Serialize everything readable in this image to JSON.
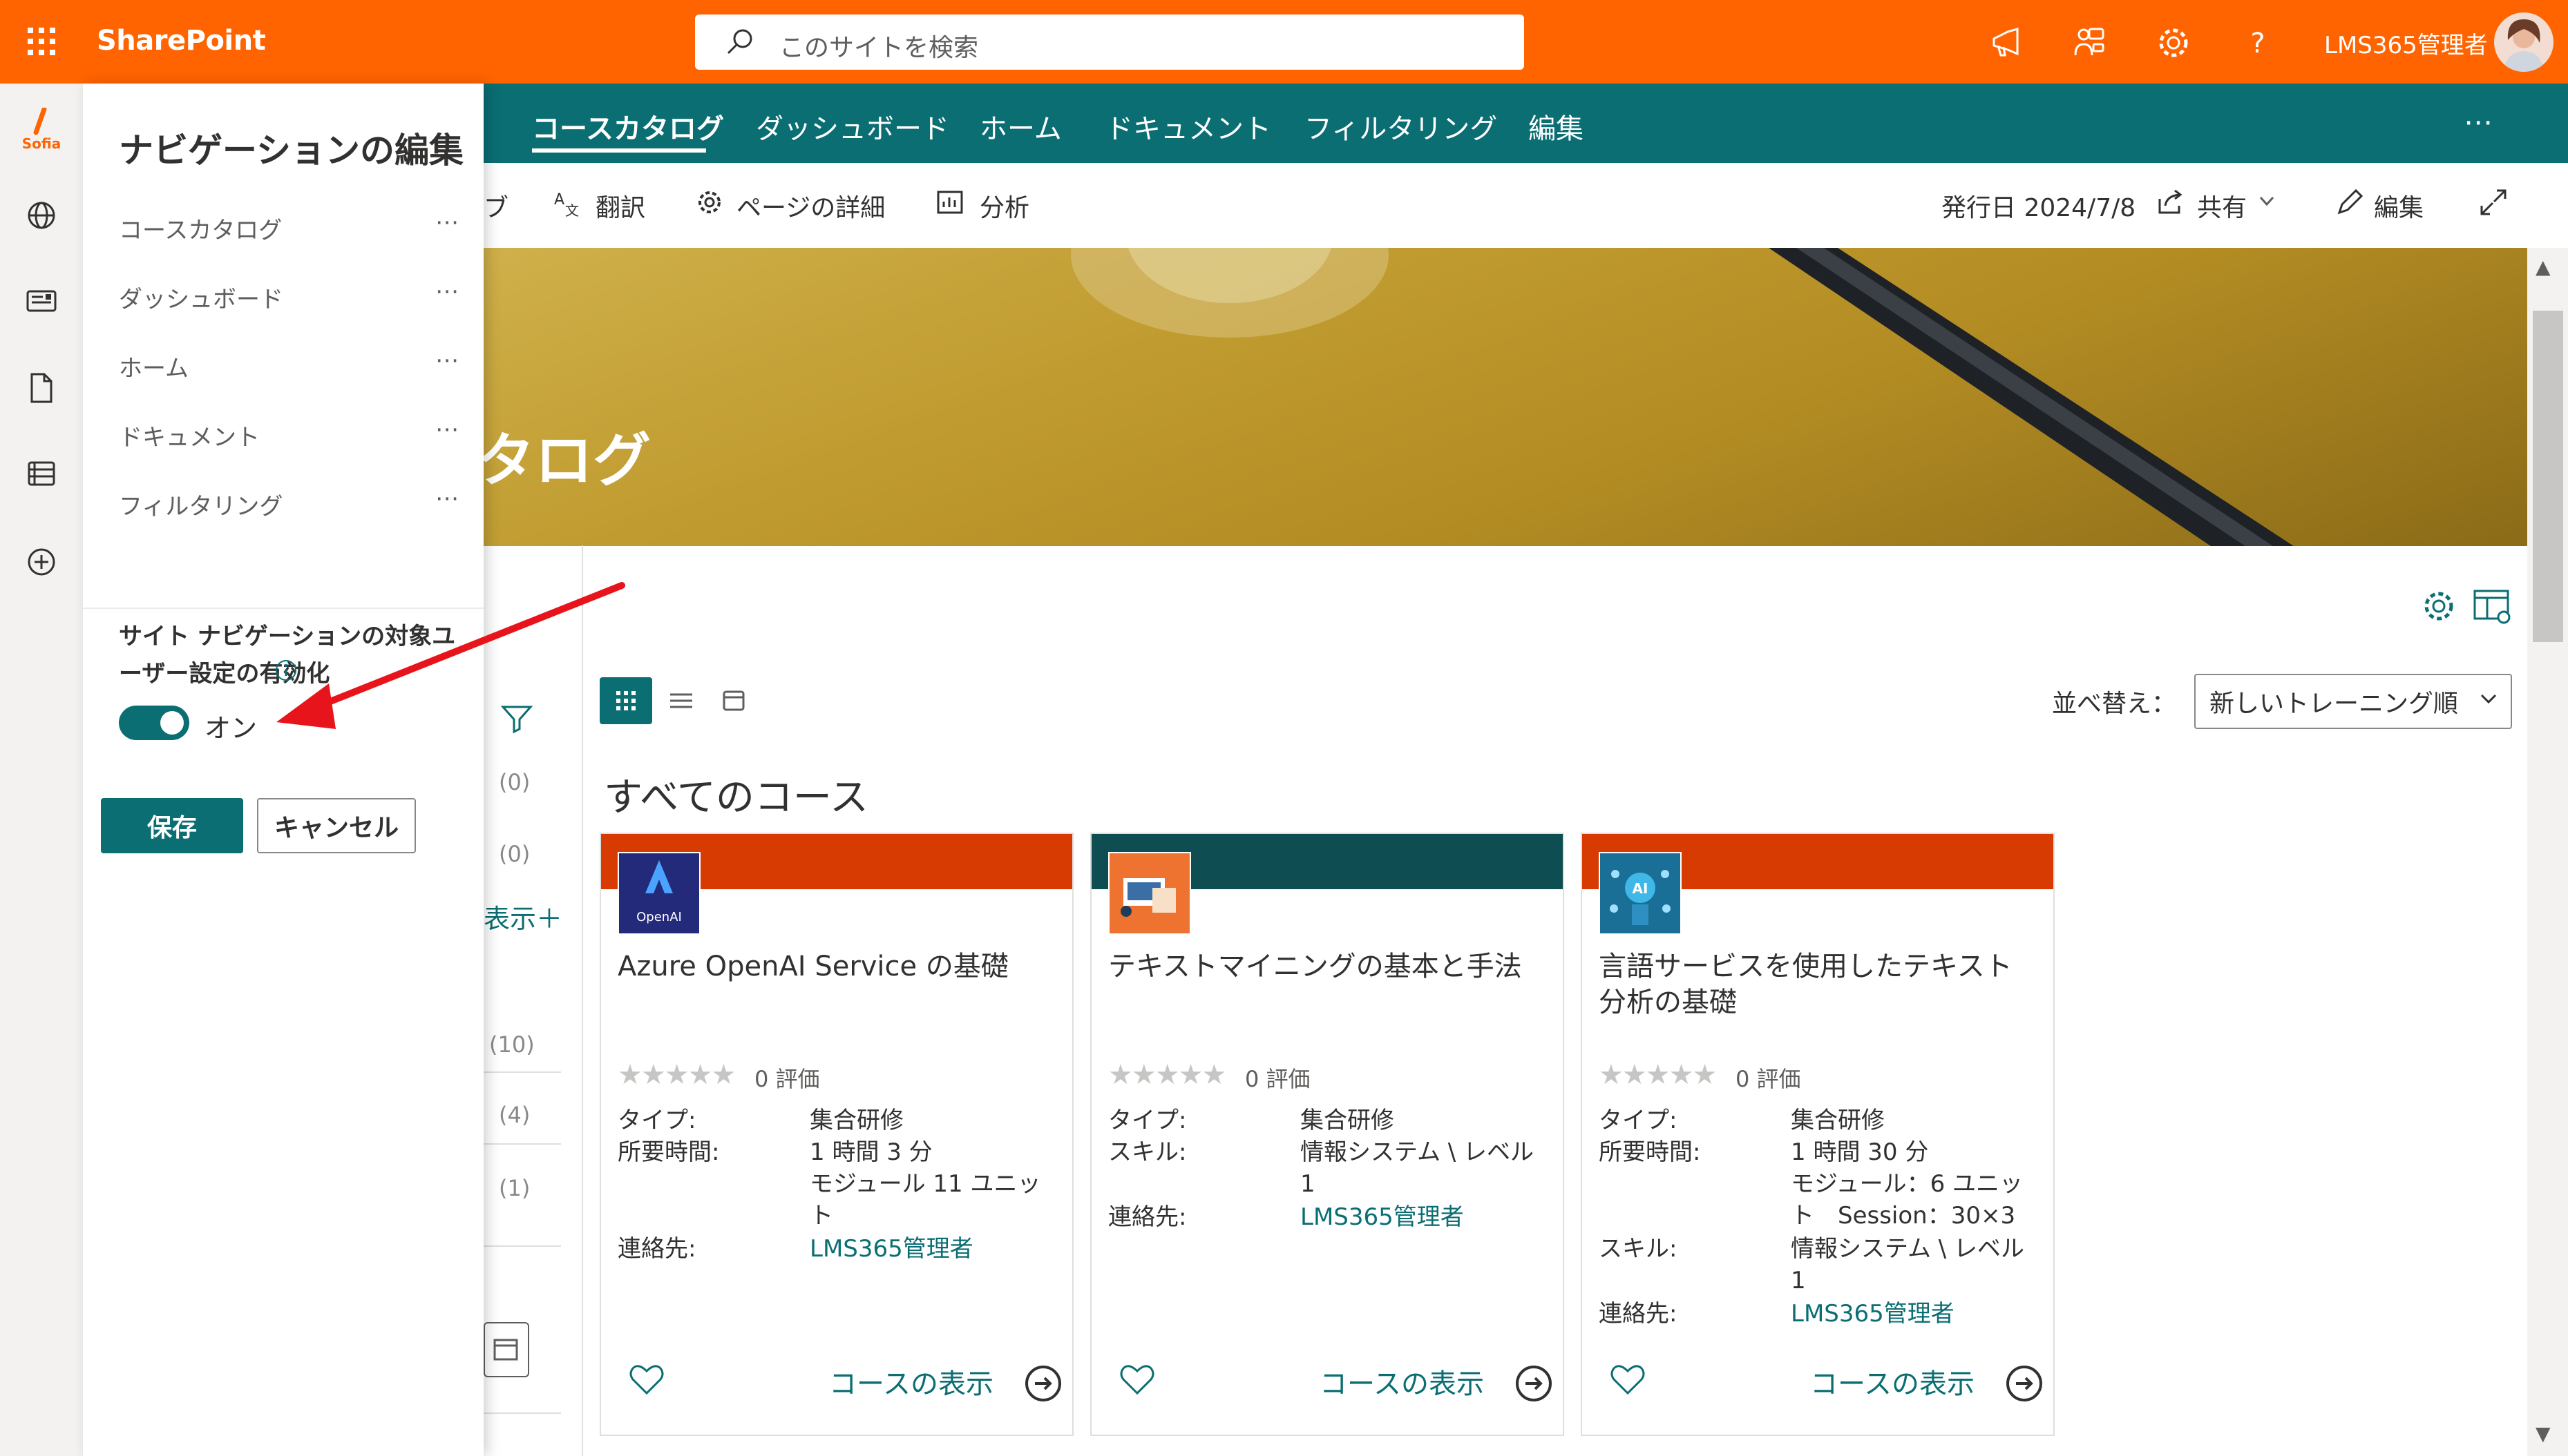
{
  "suite_bar": {
    "app_name": "SharePoint",
    "search_placeholder": "このサイトを検索",
    "user_name": "LMS365管理者",
    "accent_color": "#ff6400"
  },
  "app_rail": {
    "logo_text": "Sofia",
    "icons": [
      "globe-icon",
      "news-icon",
      "document-icon",
      "list-icon",
      "add-circle-icon"
    ]
  },
  "site_nav": {
    "items": [
      "コースカタログ",
      "ダッシュボード",
      "ホーム",
      "ドキュメント",
      "フィルタリング",
      "編集"
    ],
    "active": "コースカタログ",
    "more": "⋯",
    "color": "#0a6e73"
  },
  "command_bar": {
    "partial_left": "ブ",
    "translate": "翻訳",
    "page_details": "ページの詳細",
    "analytics": "分析",
    "published": "発行日 2024/7/8",
    "share": "共有",
    "edit": "編集"
  },
  "hero": {
    "title_partial": "タログ"
  },
  "filters": {
    "counts": [
      "(0)",
      "(0)",
      "(10)",
      "(4)",
      "(1)"
    ],
    "show_more": "表示＋"
  },
  "content": {
    "sort_label": "並べ替え：",
    "sort_value": "新しいトレーニング順",
    "section_title": "すべてのコース"
  },
  "courses": [
    {
      "title": "Azure OpenAI Service の基礎",
      "band_color": "#d83b01",
      "thumb_label": "OpenAI",
      "rating": "0 評価",
      "type_label": "タイプ:",
      "type_value": "集合研修",
      "duration_label": "所要時間:",
      "duration_value": "1 時間 3 分",
      "modules_value": "モジュール 11 ユニット",
      "contact_label": "連絡先:",
      "contact_value": "LMS365管理者",
      "view_label": "コースの表示"
    },
    {
      "title": "テキストマイニングの基本と手法",
      "band_color": "#0e4d52",
      "rating": "0 評価",
      "type_label": "タイプ:",
      "type_value": "集合研修",
      "skill_label": "スキル:",
      "skill_value": "情報システム \\ レベル 1",
      "contact_label": "連絡先:",
      "contact_value": "LMS365管理者",
      "view_label": "コースの表示"
    },
    {
      "title": "言語サービスを使用したテキスト分析の基礎",
      "band_color": "#d83b01",
      "rating": "0 評価",
      "type_label": "タイプ:",
      "type_value": "集合研修",
      "duration_label": "所要時間:",
      "duration_value": "1 時間 30 分",
      "modules_value": "モジュール：6 ユニット　Session：30×3",
      "skill_label": "スキル:",
      "skill_value": "情報システム \\ レベル 1",
      "contact_label": "連絡先:",
      "contact_value": "LMS365管理者",
      "view_label": "コースの表示"
    }
  ],
  "nav_panel": {
    "title": "ナビゲーションの編集",
    "items": [
      "コースカタログ",
      "ダッシュボード",
      "ホーム",
      "ドキュメント",
      "フィルタリング"
    ],
    "item_more": "⋯",
    "audience_label": "サイト ナビゲーションの対象ユーザー設定の有効化",
    "toggle_state": "オン",
    "toggle_on": true,
    "save": "保存",
    "cancel": "キャンセル"
  },
  "annotation": {
    "arrow_color": "#e8141b"
  }
}
